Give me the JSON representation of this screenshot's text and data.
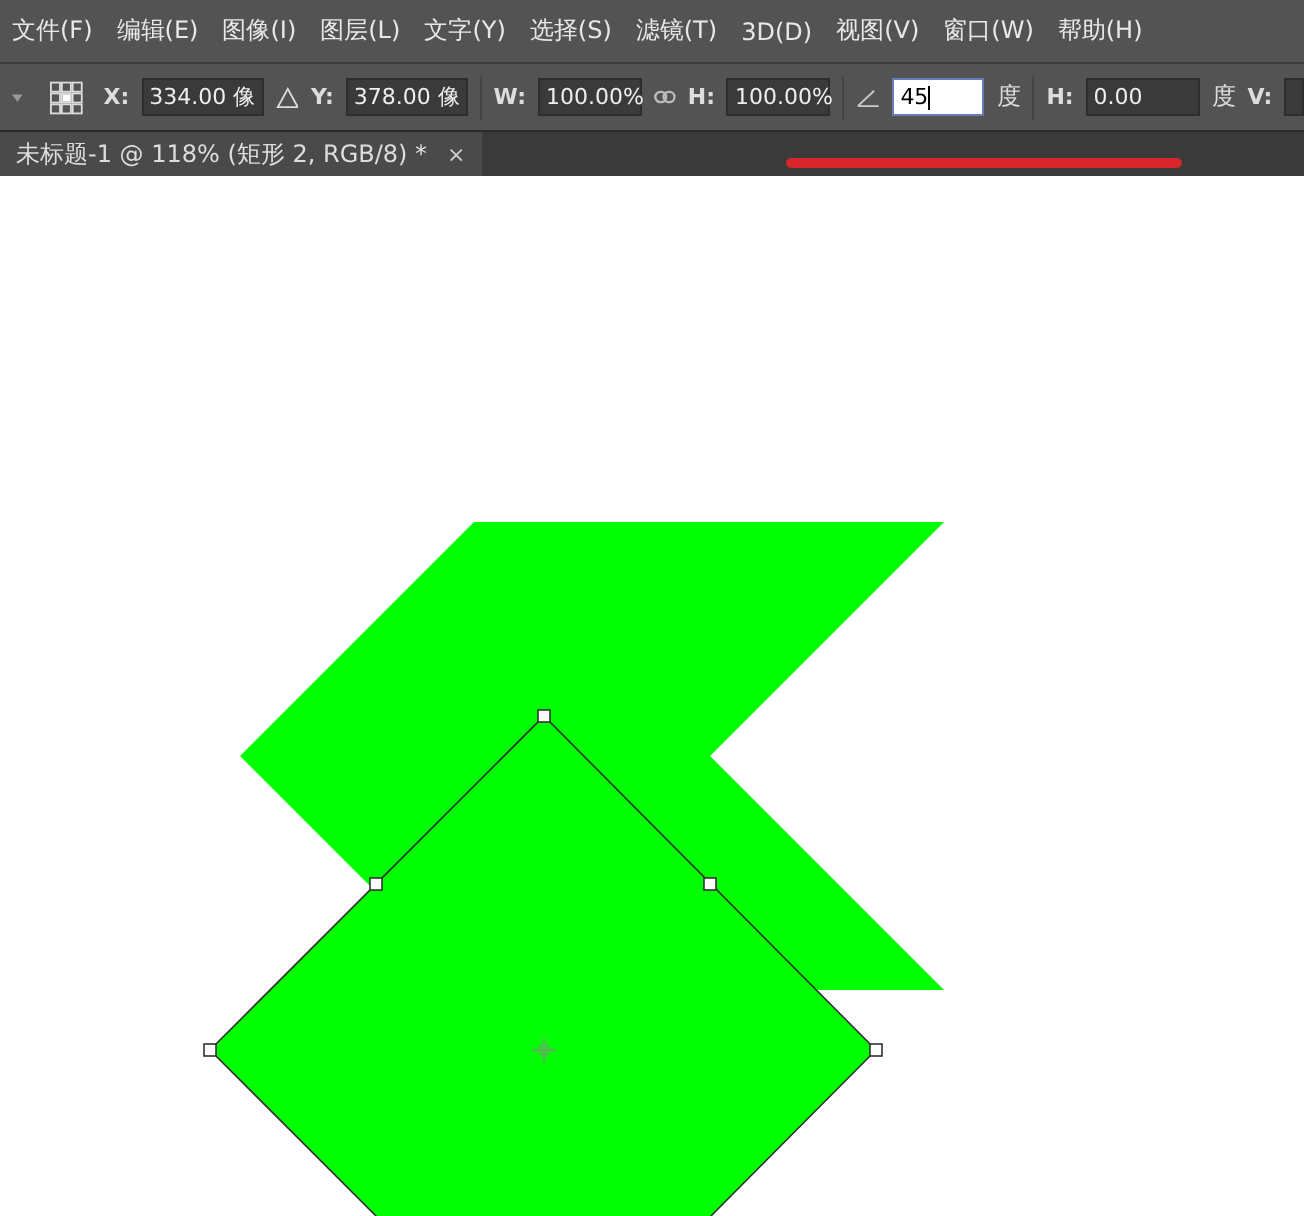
{
  "menu": [
    "文件(F)",
    "编辑(E)",
    "图像(I)",
    "图层(L)",
    "文字(Y)",
    "选择(S)",
    "滤镜(T)",
    "3D(D)",
    "视图(V)",
    "窗口(W)",
    "帮助(H)"
  ],
  "toolbar": {
    "x": {
      "label": "X:",
      "value": "334.00 像"
    },
    "y": {
      "label": "Y:",
      "value": "378.00 像"
    },
    "w": {
      "label": "W:",
      "value": "100.00%"
    },
    "h": {
      "label": "H:",
      "value": "100.00%"
    },
    "angle": {
      "value": "45",
      "unit": "度",
      "focused": true
    },
    "skew_h": {
      "label": "H:",
      "value": "0.00",
      "unit": "度"
    },
    "skew_v": {
      "label": "V:"
    }
  },
  "document_tab": {
    "title": "未标题-1 @ 118% (矩形 2, RGB/8) *",
    "close": "×"
  }
}
